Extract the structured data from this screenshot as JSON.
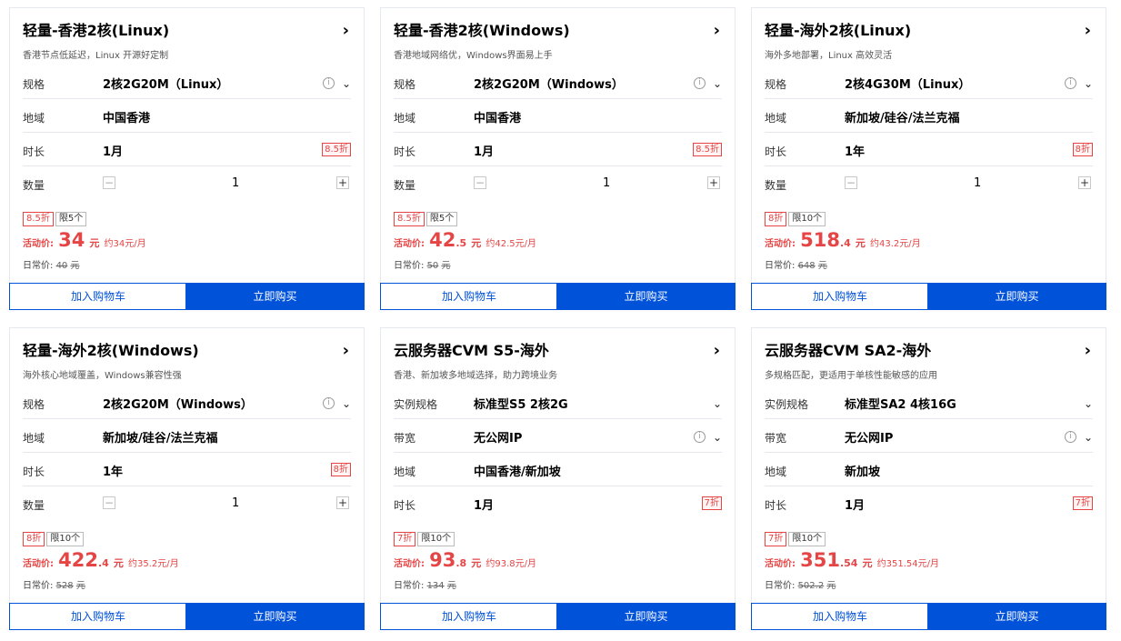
{
  "ui": {
    "spec_label": "规格",
    "instance_spec_label": "实例规格",
    "bandwidth_label": "带宽",
    "region_label": "地域",
    "duration_label": "时长",
    "qty_label": "数量",
    "promo_label": "活动价:",
    "regular_label": "日常价:",
    "yuan": "元",
    "cart_button": "加入购物车",
    "buy_button": "立即购买",
    "minus": "−",
    "plus": "+",
    "arrow": "›",
    "info": "i",
    "chevron": "⌄"
  },
  "colors": {
    "accent": "#0052d9",
    "price_red": "#e54545",
    "border": "#e5e8ee"
  },
  "icons": {
    "arrow": "chevron-right-icon",
    "info": "info-circle-icon",
    "dropdown": "chevron-down-icon"
  },
  "cards": [
    {
      "title": "轻量-香港2核(Linux)",
      "subtitle": "香港节点低延迟，Linux 开源好定制",
      "row1_value": "2核2G20M（Linux）",
      "region": "中国香港",
      "duration": "1月",
      "discount": "8.5折",
      "quantity": "1",
      "tag_discount": "8.5折",
      "tag_limit": "限5个",
      "price_int": "34",
      "price_dec": "",
      "monthly": "约34元/月",
      "orig_price": "40"
    },
    {
      "title": "轻量-香港2核(Windows)",
      "subtitle": "香港地域网络优，Windows界面易上手",
      "row1_value": "2核2G20M（Windows）",
      "region": "中国香港",
      "duration": "1月",
      "discount": "8.5折",
      "quantity": "1",
      "tag_discount": "8.5折",
      "tag_limit": "限5个",
      "price_int": "42",
      "price_dec": ".5",
      "monthly": "约42.5元/月",
      "orig_price": "50"
    },
    {
      "title": "轻量-海外2核(Linux)",
      "subtitle": "海外多地部署，Linux 高效灵活",
      "row1_value": "2核4G30M（Linux）",
      "region": "新加坡/硅谷/法兰克福",
      "duration": "1年",
      "discount": "8折",
      "quantity": "1",
      "tag_discount": "8折",
      "tag_limit": "限10个",
      "price_int": "518",
      "price_dec": ".4",
      "monthly": "约43.2元/月",
      "orig_price": "648"
    },
    {
      "title": "轻量-海外2核(Windows)",
      "subtitle": "海外核心地域覆盖，Windows兼容性强",
      "row1_value": "2核2G20M（Windows）",
      "region": "新加坡/硅谷/法兰克福",
      "duration": "1年",
      "discount": "8折",
      "quantity": "1",
      "tag_discount": "8折",
      "tag_limit": "限10个",
      "price_int": "422",
      "price_dec": ".4",
      "monthly": "约35.2元/月",
      "orig_price": "528"
    },
    {
      "title": "云服务器CVM S5-海外",
      "subtitle": "香港、新加坡多地域选择，助力跨境业务",
      "row1_value": "标准型S5 2核2G",
      "bandwidth": "无公网IP",
      "region": "中国香港/新加坡",
      "duration": "1月",
      "discount": "7折",
      "tag_discount": "7折",
      "tag_limit": "限10个",
      "price_int": "93",
      "price_dec": ".8",
      "monthly": "约93.8元/月",
      "orig_price": "134"
    },
    {
      "title": "云服务器CVM SA2-海外",
      "subtitle": "多规格匹配，更适用于单核性能敏感的应用",
      "row1_value": "标准型SA2 4核16G",
      "bandwidth": "无公网IP",
      "region": "新加坡",
      "duration": "1月",
      "discount": "7折",
      "tag_discount": "7折",
      "tag_limit": "限10个",
      "price_int": "351",
      "price_dec": ".54",
      "monthly": "约351.54元/月",
      "orig_price": "502.2"
    }
  ]
}
